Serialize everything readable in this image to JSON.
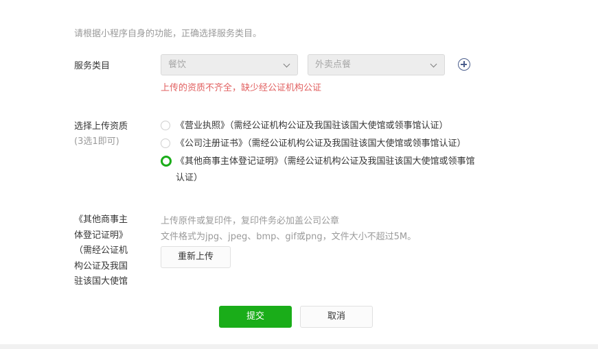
{
  "intro": "请根据小程序自身的功能，正确选择服务类目。",
  "service_category": {
    "label": "服务类目",
    "primary": "餐饮",
    "secondary": "外卖点餐",
    "error": "上传的资质不齐全，缺少经公证机构公证"
  },
  "qualification": {
    "label": "选择上传资质",
    "sublabel": "(3选1即可)",
    "options": [
      {
        "text": "《营业执照》（需经公证机构公证及我国驻该国大使馆或领事馆认证）",
        "checked": false
      },
      {
        "text": "《公司注册证书》（需经公证机构公证及我国驻该国大使馆或领事馆认证）",
        "checked": false
      },
      {
        "text_line1": "《其他商事主体登记证明》（需经公证机构公证及我国驻该国大使馆或领事馆",
        "text_line2": "认证）",
        "checked": true
      }
    ]
  },
  "upload": {
    "label_lines": [
      "《其他商事主",
      "体登记证明》",
      "（需经公证机",
      "构公证及我国",
      "驻该国大使馆"
    ],
    "hint1": "上传原件或复印件，复印件务必加盖公司公章",
    "hint2": "文件格式为jpg、jpeg、bmp、gif或png，文件大小不超过5M。",
    "reupload": "重新上传"
  },
  "actions": {
    "submit": "提交",
    "cancel": "取消"
  },
  "colors": {
    "primary_green": "#1aad19",
    "error_red": "#e15f5f",
    "muted_text": "#9a9a9a"
  }
}
